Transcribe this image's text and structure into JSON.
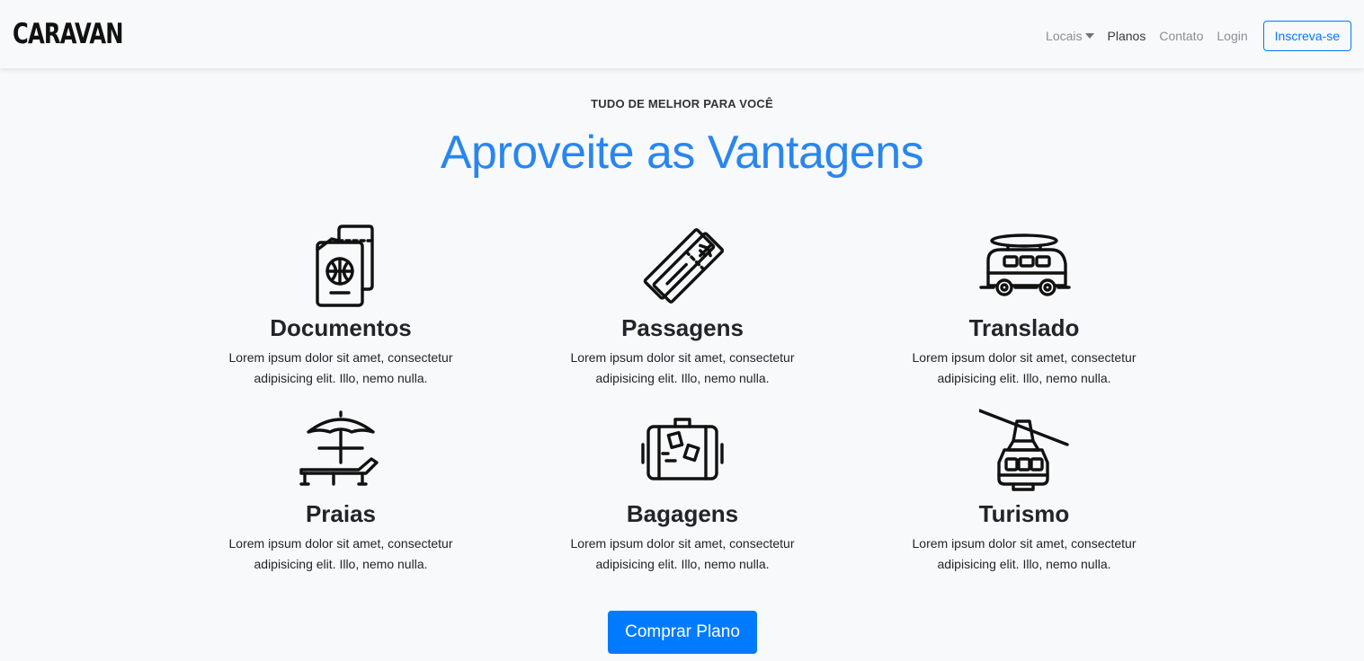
{
  "navbar": {
    "brand": "CARAVAN",
    "links": [
      {
        "label": "Locais"
      },
      {
        "label": "Planos"
      },
      {
        "label": "Contato"
      },
      {
        "label": "Login"
      }
    ],
    "signup_label": "Inscreva-se"
  },
  "section": {
    "kicker": "TUDO DE MELHOR PARA VOCÊ",
    "title": "Aproveite as Vantagens"
  },
  "features": [
    {
      "title": "Documentos",
      "text": "Lorem ipsum dolor sit amet, consectetur adipisicing elit. Illo, nemo nulla.",
      "icon": "passport-icon"
    },
    {
      "title": "Passagens",
      "text": "Lorem ipsum dolor sit amet, consectetur adipisicing elit. Illo, nemo nulla.",
      "icon": "plane-ticket-icon"
    },
    {
      "title": "Translado",
      "text": "Lorem ipsum dolor sit amet, consectetur adipisicing elit. Illo, nemo nulla.",
      "icon": "van-icon"
    },
    {
      "title": "Praias",
      "text": "Lorem ipsum dolor sit amet, consectetur adipisicing elit. Illo, nemo nulla.",
      "icon": "beach-umbrella-icon"
    },
    {
      "title": "Bagagens",
      "text": "Lorem ipsum dolor sit amet, consectetur adipisicing elit. Illo, nemo nulla.",
      "icon": "suitcase-icon"
    },
    {
      "title": "Turismo",
      "text": "Lorem ipsum dolor sit amet, consectetur adipisicing elit. Illo, nemo nulla.",
      "icon": "cable-car-icon"
    }
  ],
  "cta": {
    "label": "Comprar Plano"
  },
  "colors": {
    "accent": "#007bff",
    "headline": "#2a86ee",
    "background": "#f8f9fa"
  }
}
